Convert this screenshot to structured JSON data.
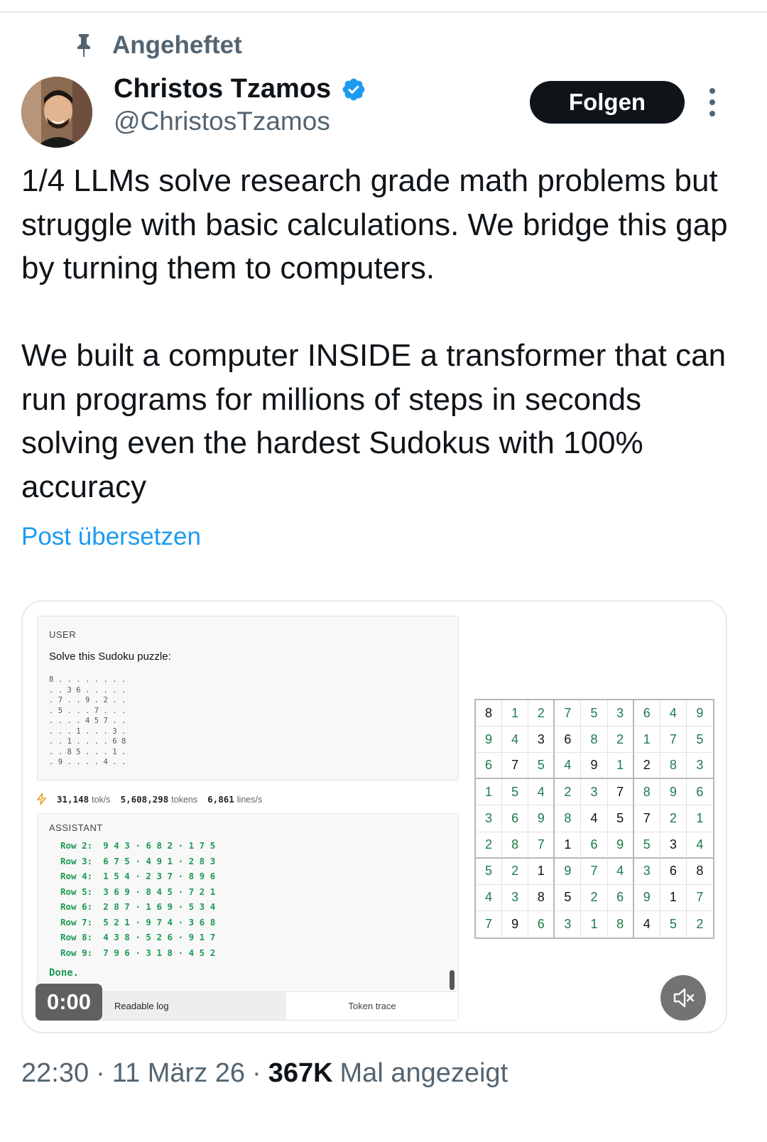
{
  "pinned_label": "Angeheftet",
  "author": {
    "name": "Christos Tzamos",
    "handle": "@ChristosTzamos"
  },
  "follow_label": "Folgen",
  "tweet": {
    "paragraph1": "1/4 LLMs solve research grade math problems but struggle with basic calculations. We bridge this gap by turning them to computers.",
    "paragraph2": "We built a computer INSIDE a transformer that can run programs for millions of steps in seconds solving even the hardest Sudokus with 100% accuracy"
  },
  "translate_label": "Post übersetzen",
  "media": {
    "user_label": "USER",
    "user_prompt": "Solve this Sudoku puzzle:",
    "puzzle_lines": [
      "8 . . . . . . . .",
      ". . 3 6 . . . . .",
      ". 7 . . 9 . 2 . .",
      ". 5 . . . 7 . . .",
      ". . . . 4 5 7 . .",
      ". . . 1 . . . 3 .",
      ". . 1 . . . . 6 8",
      ". . 8 5 . . . 1 .",
      ". 9 . . . . 4 . ."
    ],
    "stats": {
      "tok_rate": "31,148",
      "tok_rate_unit": "tok/s",
      "tokens": "5,608,298",
      "tokens_unit": "tokens",
      "lines_rate": "6,861",
      "lines_rate_unit": "lines/s"
    },
    "assistant_label": "ASSISTANT",
    "assistant_rows": [
      "Row 2:  9 4 3 · 6 8 2 · 1 7 5",
      "Row 3:  6 7 5 · 4 9 1 · 2 8 3",
      "Row 4:  1 5 4 · 2 3 7 · 8 9 6",
      "Row 5:  3 6 9 · 8 4 5 · 7 2 1",
      "Row 6:  2 8 7 · 1 6 9 · 5 3 4",
      "Row 7:  5 2 1 · 9 7 4 · 3 6 8",
      "Row 8:  4 3 8 · 5 2 6 · 9 1 7",
      "Row 9:  7 9 6 · 3 1 8 · 4 5 2"
    ],
    "done_label": "Done.",
    "tab_readable": "Readable log",
    "tab_trace": "Token trace",
    "video_time": "0:00",
    "sudoku_grid": [
      [
        8,
        1,
        2,
        7,
        5,
        3,
        6,
        4,
        9
      ],
      [
        9,
        4,
        3,
        6,
        8,
        2,
        1,
        7,
        5
      ],
      [
        6,
        7,
        5,
        4,
        9,
        1,
        2,
        8,
        3
      ],
      [
        1,
        5,
        4,
        2,
        3,
        7,
        8,
        9,
        6
      ],
      [
        3,
        6,
        9,
        8,
        4,
        5,
        7,
        2,
        1
      ],
      [
        2,
        8,
        7,
        1,
        6,
        9,
        5,
        3,
        4
      ],
      [
        5,
        2,
        1,
        9,
        7,
        4,
        3,
        6,
        8
      ],
      [
        4,
        3,
        8,
        5,
        2,
        6,
        9,
        1,
        7
      ],
      [
        7,
        9,
        6,
        3,
        1,
        8,
        4,
        5,
        2
      ]
    ],
    "sudoku_given_mask": [
      [
        1,
        0,
        0,
        0,
        0,
        0,
        0,
        0,
        0
      ],
      [
        0,
        0,
        1,
        1,
        0,
        0,
        0,
        0,
        0
      ],
      [
        0,
        1,
        0,
        0,
        1,
        0,
        1,
        0,
        0
      ],
      [
        0,
        0,
        0,
        0,
        0,
        1,
        0,
        0,
        0
      ],
      [
        0,
        0,
        0,
        0,
        1,
        1,
        1,
        0,
        0
      ],
      [
        0,
        0,
        0,
        1,
        0,
        0,
        0,
        1,
        0
      ],
      [
        0,
        0,
        1,
        0,
        0,
        0,
        0,
        1,
        1
      ],
      [
        0,
        0,
        1,
        1,
        0,
        0,
        0,
        1,
        0
      ],
      [
        0,
        1,
        0,
        0,
        0,
        0,
        1,
        0,
        0
      ]
    ],
    "colors": {
      "given": "#111111",
      "solved": "#1c7a4a",
      "assistant_text": "#1c9a52"
    }
  },
  "footer": {
    "time": "22:30",
    "date": "11 März 26",
    "views": "367K",
    "views_label": "Mal angezeigt"
  },
  "colors": {
    "accent": "#1d9bf0",
    "secondary_text": "#536471",
    "verified": "#1d9bf0"
  }
}
